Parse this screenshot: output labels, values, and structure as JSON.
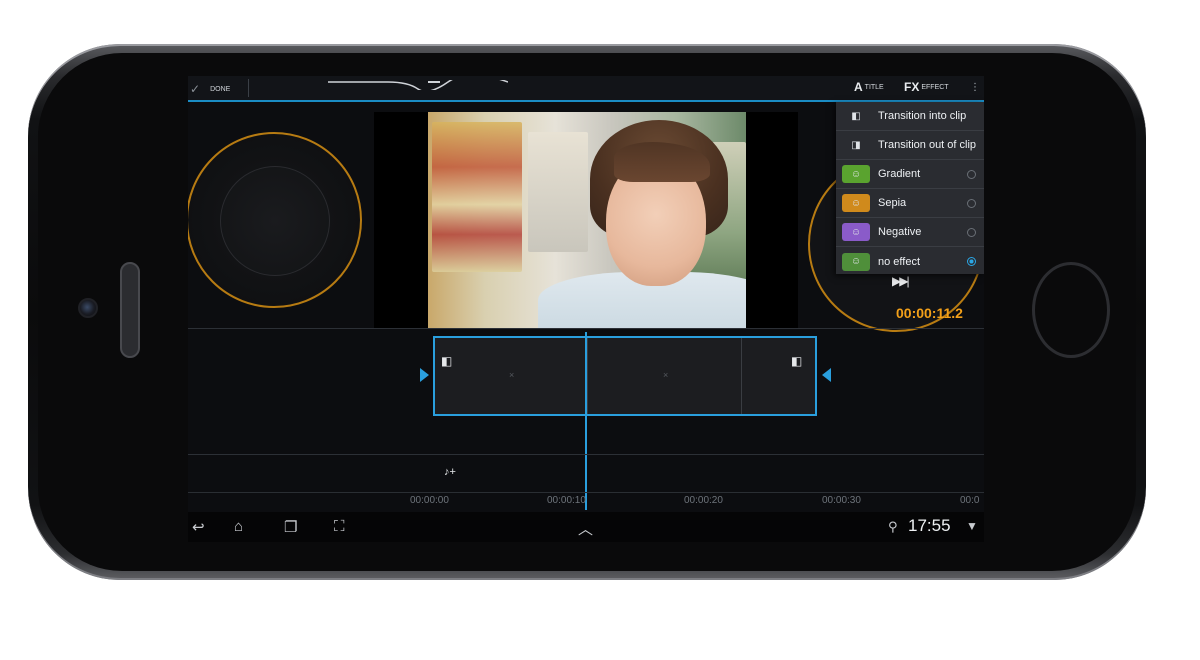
{
  "topbar": {
    "done_label": "DONE",
    "title_label": "TITLE",
    "effect_label": "EFFECT",
    "title_glyph": "A",
    "effect_glyph": "FX"
  },
  "menu": {
    "items": [
      {
        "label": "Transition into clip",
        "icon": "transition-in-icon",
        "icon_color": "#2a2c31",
        "radio": null
      },
      {
        "label": "Transition out of clip",
        "icon": "transition-out-icon",
        "icon_color": "#2a2c31",
        "radio": null
      },
      {
        "label": "Gradient",
        "icon": "gradient-thumb-icon",
        "icon_color": "#5aa32f",
        "radio": false
      },
      {
        "label": "Sepia",
        "icon": "sepia-thumb-icon",
        "icon_color": "#d08a1c",
        "radio": false
      },
      {
        "label": "Negative",
        "icon": "negative-thumb-icon",
        "icon_color": "#8a5bc9",
        "radio": false
      },
      {
        "label": "no effect",
        "icon": "no-effect-thumb-icon",
        "icon_color": "#4f8f3a",
        "radio": true
      }
    ]
  },
  "preview": {
    "timecode": "00:00:11.2"
  },
  "timeline": {
    "ruler": [
      "00:00:00",
      "00:00:10",
      "00:00:20",
      "00:00:30",
      "00:0"
    ]
  },
  "statusbar": {
    "clock": "17:55"
  },
  "colors": {
    "accent": "#2a9fde",
    "orange": "#f29a1b"
  }
}
